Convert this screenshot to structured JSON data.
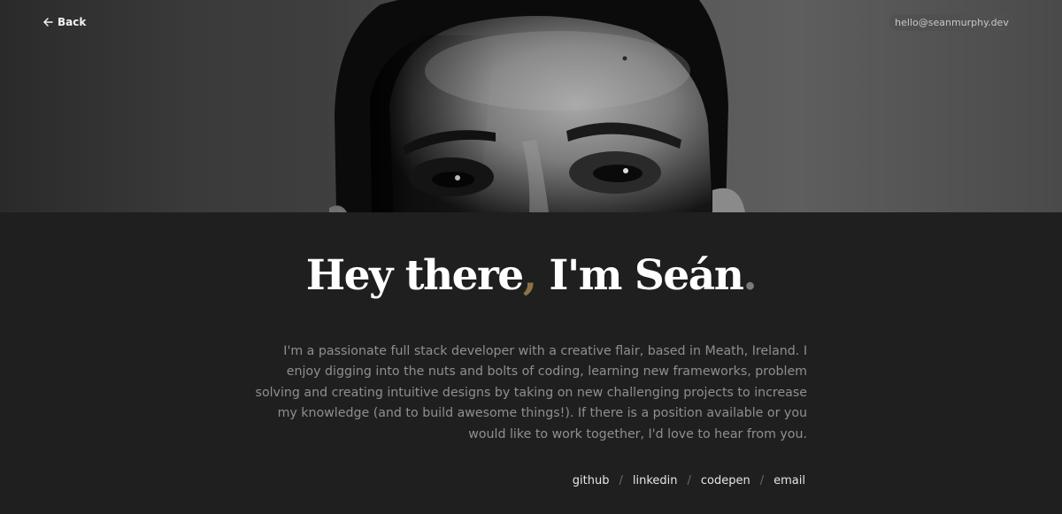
{
  "nav": {
    "back_label": "Back",
    "email": "hello@seanmurphy.dev"
  },
  "hero": {
    "headline_main": "Hey there",
    "headline_comma": ",",
    "headline_rest": " I'm Seán",
    "headline_dot": "."
  },
  "intro": "I'm a passionate full stack developer with a creative flair, based in Meath, Ireland. I enjoy digging into the nuts and bolts of coding, learning new frameworks, problem solving and creating intuitive designs by taking on new challenging projects to increase my knowledge (and to build awesome things!). If there is a position available or you would like to work together, I'd love to hear from you.",
  "social": {
    "links": [
      "github",
      "linkedin",
      "codepen",
      "email"
    ],
    "separator": "/"
  },
  "colors": {
    "accent_comma": "#8a7345",
    "accent_dot": "#7a7a7a",
    "background": "#1f1f1f"
  }
}
